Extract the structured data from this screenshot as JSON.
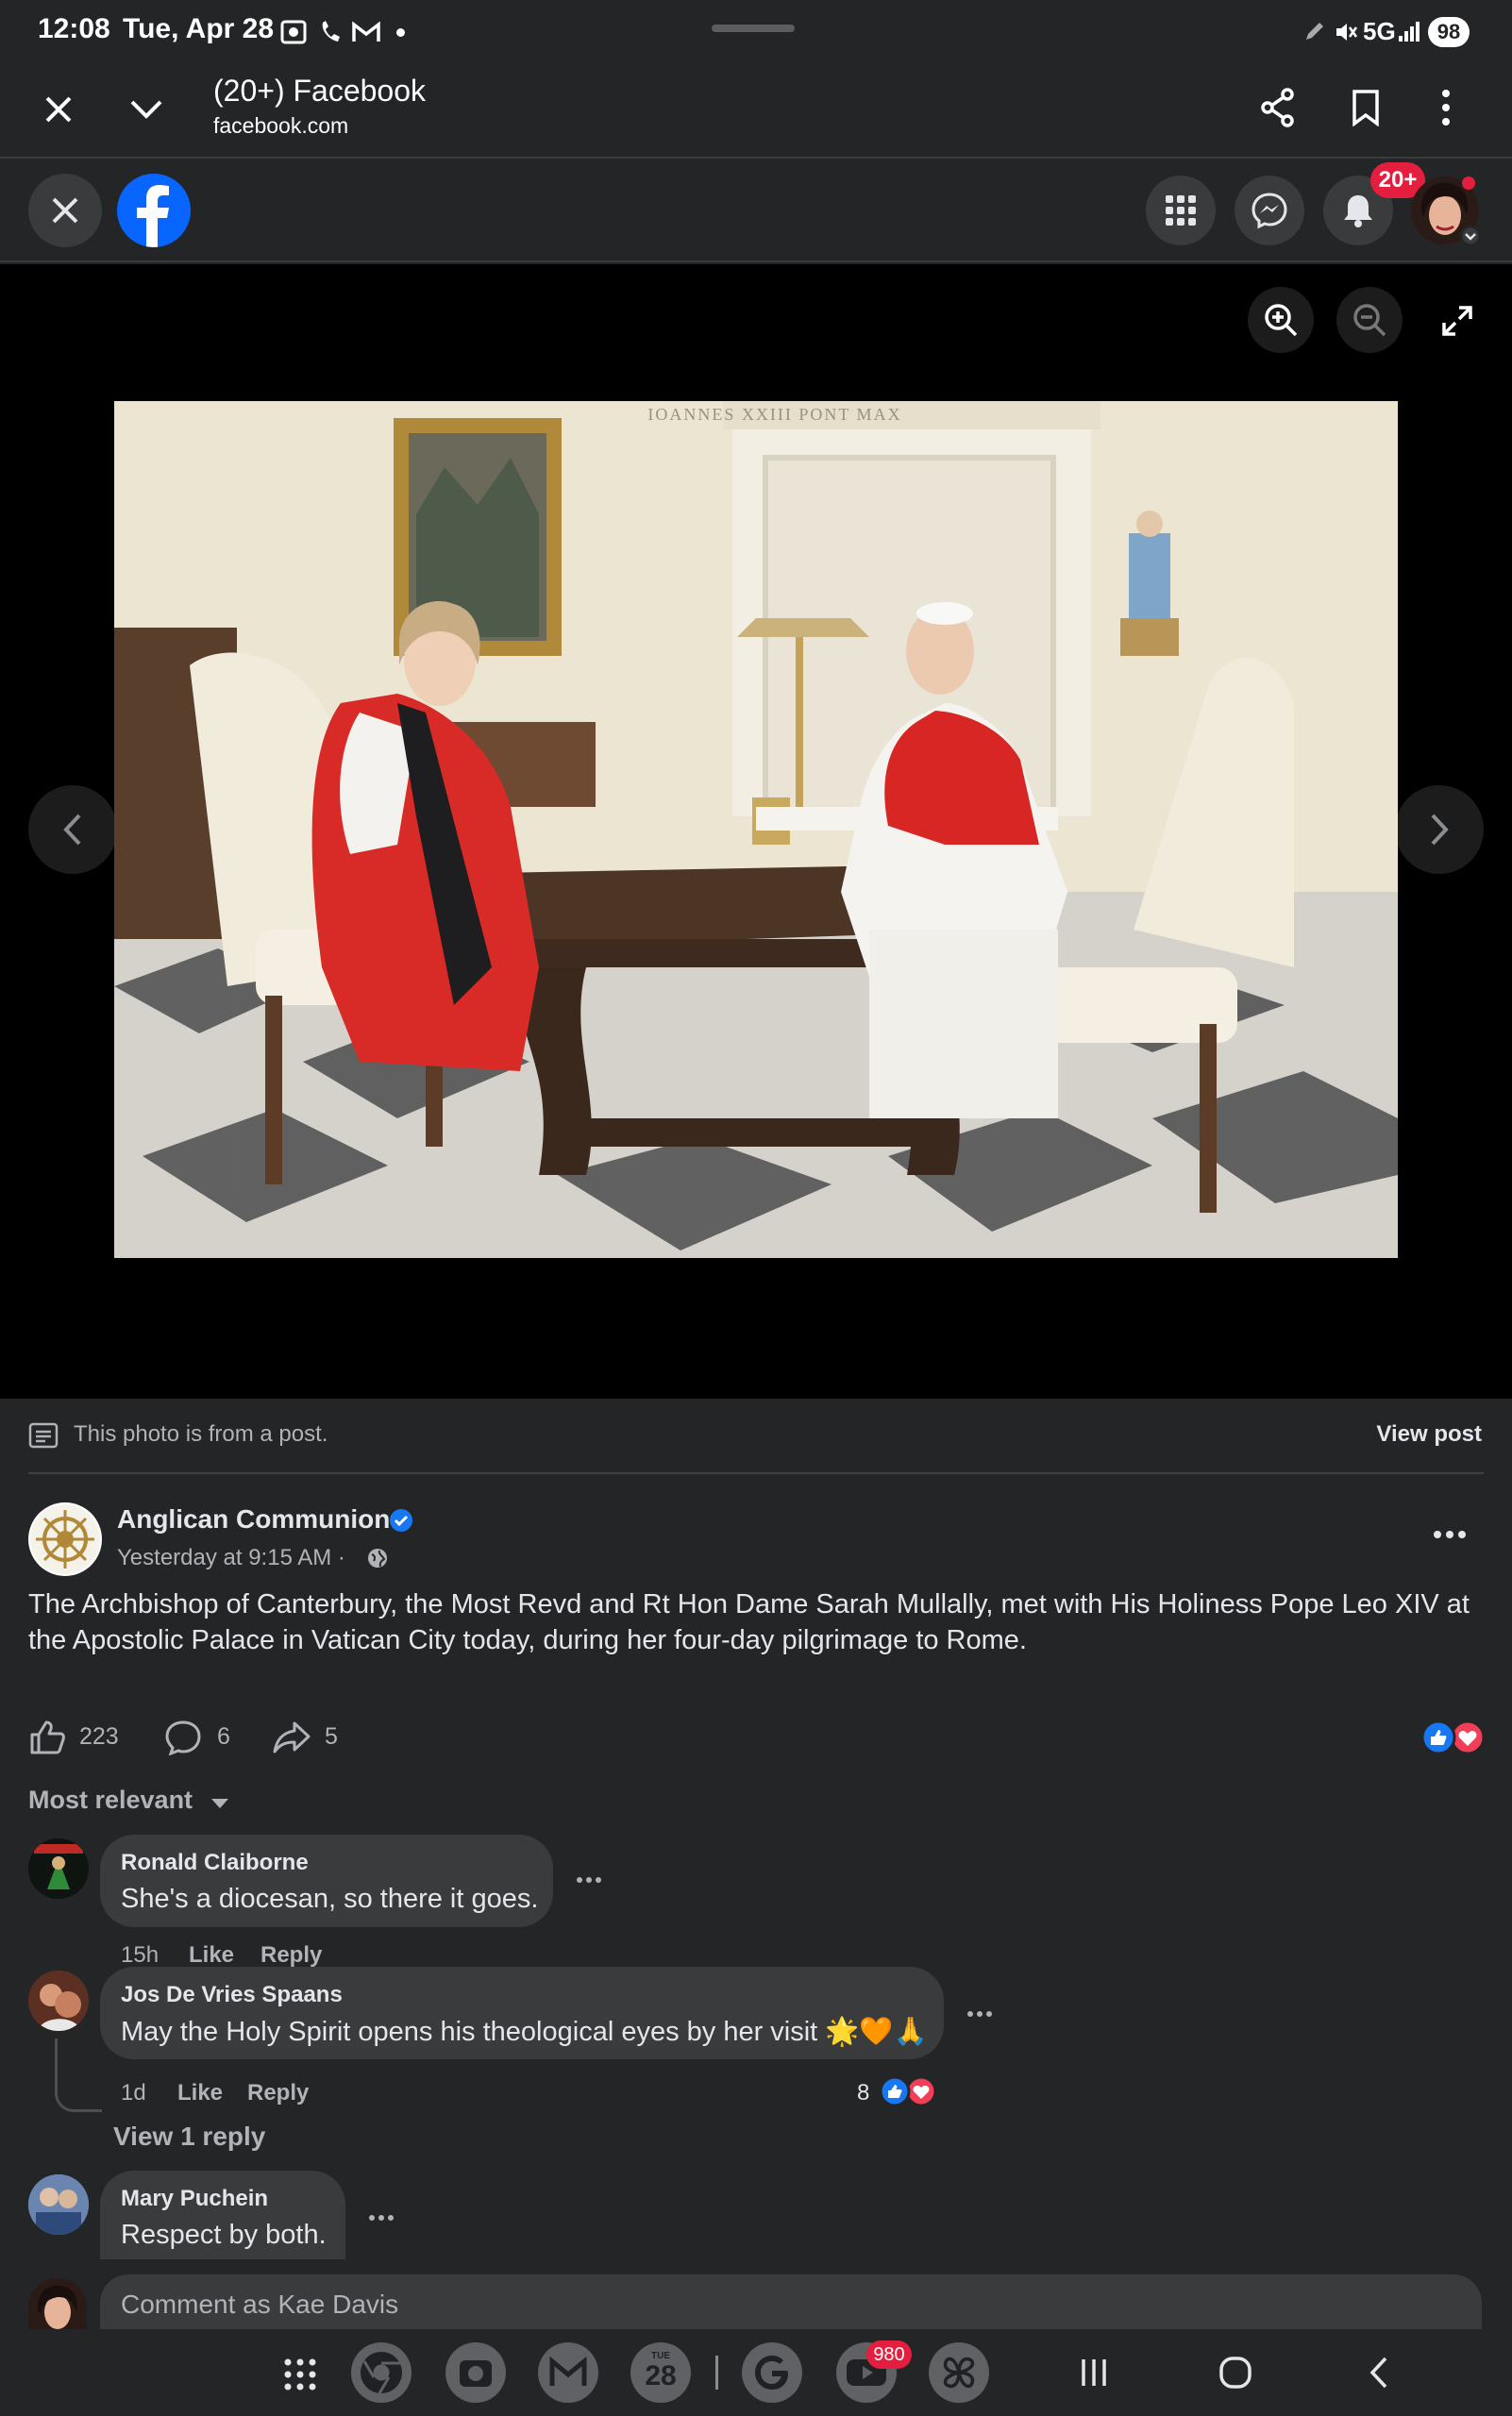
{
  "status_bar": {
    "time": "12:08",
    "date": "Tue, Apr 28",
    "network": "5G",
    "battery": "98"
  },
  "browser": {
    "title": "(20+) Facebook",
    "url": "facebook.com"
  },
  "fb_header": {
    "notifications_badge": "20+"
  },
  "photo": {
    "inscription": "IOANNES XXIII PONT MAX"
  },
  "post_notice": {
    "text": "This photo is from a post.",
    "view_post": "View post"
  },
  "post": {
    "author": "Anglican Communion",
    "timestamp": "Yesterday at 9:15 AM ·",
    "body_line1": "The Archbishop of Canterbury, the Most Revd and Rt Hon Dame Sarah Mullally, met with His Holiness Pope Leo XIV at",
    "body_line2": "the Apostolic Palace in Vatican City today, during her four-day pilgrimage to Rome.",
    "likes": "223",
    "comments": "6",
    "shares": "5"
  },
  "sort": {
    "label": "Most relevant"
  },
  "comments": [
    {
      "name": "Ronald Claiborne",
      "text": "She's a diocesan, so there it goes.",
      "age": "15h",
      "like": "Like",
      "reply": "Reply"
    },
    {
      "name": "Jos De Vries Spaans",
      "text": "May the Holy Spirit opens his theological eyes by her visit 🌟🧡🙏",
      "age": "1d",
      "like": "Like",
      "reply": "Reply",
      "reactions": "8",
      "view_replies": "View 1 reply"
    },
    {
      "name": "Mary Puchein",
      "text": "Respect by both."
    }
  ],
  "composer": {
    "placeholder": "Comment as Kae Davis"
  },
  "dock": {
    "calendar_day": "28",
    "calendar_dow": "TUE",
    "youtube_badge": "980"
  },
  "colors": {
    "background": "#242526",
    "surface": "#3a3b3c",
    "facebook_blue": "#0866ff",
    "badge_red": "#e41e3f"
  }
}
